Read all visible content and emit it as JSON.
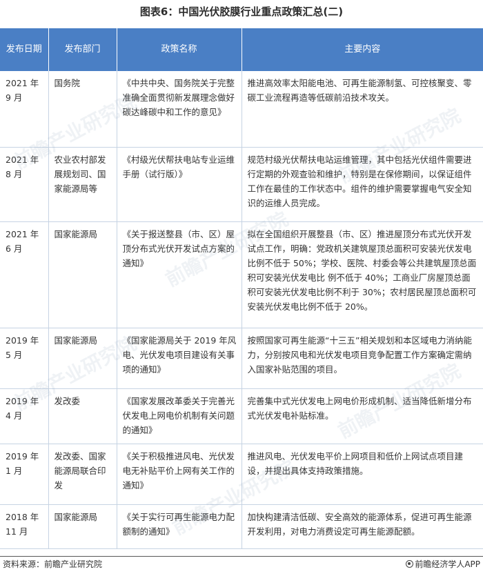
{
  "title": "图表6：中国光伏胶膜行业重点政策汇总(二)",
  "table": {
    "headers": [
      "发布日期",
      "发布部门",
      "政策名称",
      "主要内容"
    ],
    "rows": [
      {
        "date": "2021 年 9 月",
        "dept": "国务院",
        "policy": "《中共中央、国务院关于完整准确全面贯彻新发展理念做好碳达峰碳中和工作的意见》",
        "content": "推进高效率太阳能电池、可再生能源制氢、可控核聚变、零碳工业流程再造等低碳前沿技术攻关。"
      },
      {
        "date": "2021 年 8 月",
        "dept": "农业农村部发展规划司、国家能源局等",
        "policy": "《村级光伏帮扶电站专业运维手册（试行版）》",
        "content": "规范村级光伏帮扶电站运维管理，其中包括光伏组件需要进行定期的外观查验和维护，特别是在保修期间，以保证组件工作在最佳的工作状态中。组件的维护需要掌握电气安全知识的运维人员完成。"
      },
      {
        "date": "2021 年 6 月",
        "dept": "国家能源局",
        "policy": "《关于报送整县（市、区）屋顶分布式光伏开发试点方案的通知》",
        "content": "拟在全国组织开展整县（市、区）推进屋顶分布式光伏开发试点工作，明确：党政机关建筑屋顶总面积可安装光伏发电比例不低于 50%；学校、医院、村委会等公共建筑屋顶总面积可安装光伏发电比 例不低于 40%；工商业厂房屋顶总面积可安装光伏发电比例不利于 30%；农村居民屋顶总面积可安装光伏发电比例不低于 20%。"
      },
      {
        "date": "2019 年 5 月",
        "dept": "国家能源局",
        "policy": "《国家能源局关于 2019 年风电、光伏发电项目建设有关事项的通知》",
        "content": "按照国家可再生能源“十三五”相关规划和本区域电力消纳能力，分别按风电和光伏发电项目竞争配置工作方案确定需纳入国家补贴范围的项目。"
      },
      {
        "date": "2019 年 4 月",
        "dept": "发改委",
        "policy": "《国家发展改革委关于完善光伏发电上网电价机制有关问题的通知》",
        "content": "完善集中式光伏发电上网电价形成机制、适当降低新增分布式光伏发电补贴标准。"
      },
      {
        "date": "2019 年 1 月",
        "dept": "发改委、国家能源局联合印发",
        "policy": "《关于积极推进风电、光伏发电无补贴平价上网有关工作的通知》",
        "content": "推进风电、光伏发电平价上网项目和低价上网试点项目建设，并提出具体支持政策措施。"
      },
      {
        "date": "2018 年 11 月",
        "dept": "国家能源局",
        "policy": "《关于实行可再生能源电力配额制的通知》",
        "content": "加快构建清洁低碳、安全高效的能源体系，促进可再生能源开发利用，对电力消费设定可再生能源配额。"
      }
    ]
  },
  "footer": {
    "source": "资料来源：前瞻产业研究院",
    "app": "前瞻经济学人APP",
    "logo_icon": "qianzhan-logo-icon"
  },
  "watermark": {
    "text": "前瞻产业研究院",
    "color": "#8aa0b8"
  },
  "colors": {
    "header_bg": "#4a7fc5",
    "header_text": "#ffffff",
    "grid_line": "#c6d3e3"
  }
}
